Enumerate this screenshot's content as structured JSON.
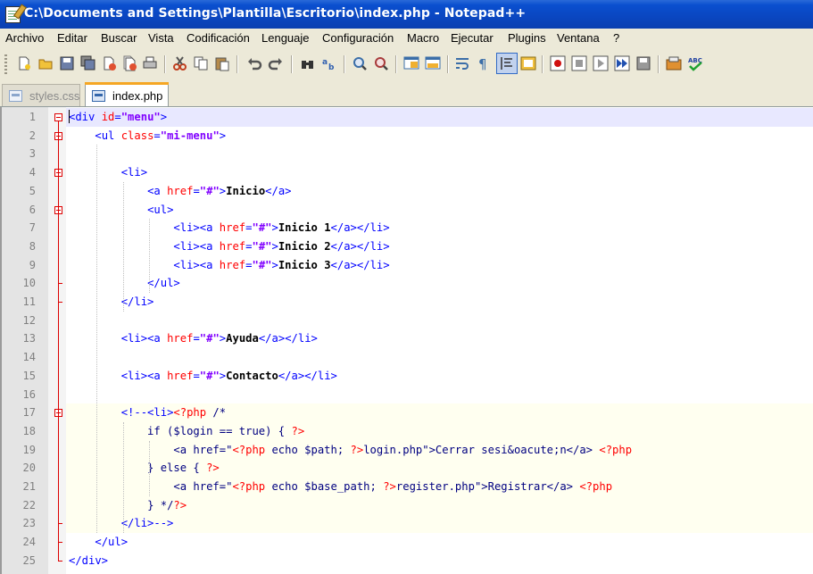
{
  "window": {
    "title": "C:\\Documents and Settings\\Plantilla\\Escritorio\\index.php - Notepad++"
  },
  "menu": [
    "Archivo",
    "Editar",
    "Buscar",
    "Vista",
    "Codificación",
    "Lenguaje",
    "Configuración",
    "Macro",
    "Ejecutar",
    "Plugins",
    "Ventana",
    "?"
  ],
  "toolbar": {
    "icons": [
      "new-file-icon",
      "open-file-icon",
      "save-icon",
      "save-all-icon",
      "close-icon",
      "close-all-icon",
      "print-icon",
      "cut-icon",
      "copy-icon",
      "paste-icon",
      "undo-icon",
      "redo-icon",
      "find-icon",
      "replace-icon",
      "zoom-in-icon",
      "zoom-out-icon",
      "sync-vertical-icon",
      "sync-horizontal-icon",
      "word-wrap-icon",
      "show-all-chars-icon",
      "indent-guide-icon",
      "doc-map-icon",
      "record-macro-icon",
      "stop-macro-icon",
      "play-macro-icon",
      "run-macro-multiple-icon",
      "save-macro-icon",
      "plugin-icon",
      "spellcheck-icon"
    ]
  },
  "tabs": [
    {
      "label": "styles.css",
      "active": false
    },
    {
      "label": "index.php",
      "active": true
    }
  ],
  "editor": {
    "lines": [
      "<div id=\"menu\">",
      "    <ul class=\"mi-menu\">",
      "",
      "        <li>",
      "            <a href=\"#\">Inicio</a>",
      "            <ul>",
      "                <li><a href=\"#\">Inicio 1</a></li>",
      "                <li><a href=\"#\">Inicio 2</a></li>",
      "                <li><a href=\"#\">Inicio 3</a></li>",
      "            </ul>",
      "        </li>",
      "",
      "        <li><a href=\"#\">Ayuda</a></li>",
      "",
      "        <li><a href=\"#\">Contacto</a></li>",
      "",
      "        <!--<li><?php /*",
      "            if ($login == true) { ?>",
      "                <a href=\"<?php echo $path; ?>login.php\">Cerrar sesi&oacute;n</a> <?php",
      "            } else { ?>",
      "                <a href=\"<?php echo $base_path; ?>register.php\">Registrar</a> <?php",
      "            } */?>",
      "        </li>-->",
      "    </ul>",
      "</div>"
    ]
  },
  "colors": {
    "titlebar": "#0a46c0",
    "fold_marker": "#dd0000",
    "tag": "#0000ff",
    "attr": "#ff0000",
    "value": "#8000ff",
    "comment": "#008000"
  }
}
